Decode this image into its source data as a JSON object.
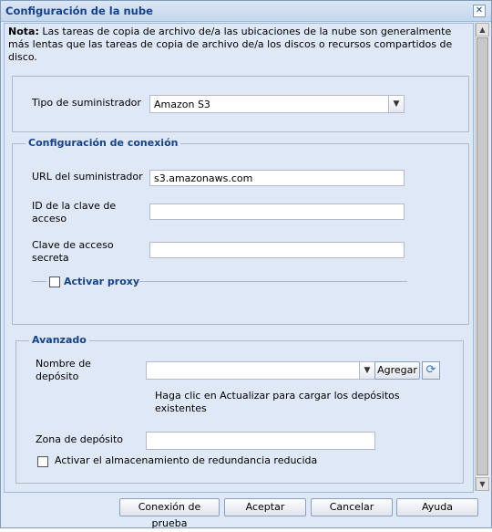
{
  "dialog": {
    "title": "Configuración de la nube",
    "close_label": "✕"
  },
  "note": {
    "bold": "Nota:",
    "text": " Las tareas de copia de archivo de/a las ubicaciones de la nube son generalmente más lentas que las tareas de copia de archivo de/a los discos o recursos compartidos de disco."
  },
  "provider": {
    "label": "Tipo de suministrador",
    "value": "Amazon S3"
  },
  "connection": {
    "legend": "Configuración de conexión",
    "url_label": "URL del suministrador",
    "url_value": "s3.amazonaws.com",
    "key_id_label_1": "ID de la clave de",
    "key_id_label_2": "acceso",
    "key_id_value": "",
    "secret_label_1": "Clave de acceso",
    "secret_label_2": "secreta",
    "secret_value": "",
    "proxy_label": "Activar proxy"
  },
  "advanced": {
    "legend": "Avanzado",
    "bucket_label_1": "Nombre de",
    "bucket_label_2": "depósito",
    "bucket_value": "",
    "add_label": "Agregar",
    "hint_1": "Haga clic en Actualizar para cargar los depósitos",
    "hint_2": "existentes",
    "zone_label": "Zona de depósito",
    "zone_value": "",
    "rrs_label": "Activar el almacenamiento de redundancia reducida"
  },
  "buttons": {
    "test": "Conexión de prueba",
    "ok": "Aceptar",
    "cancel": "Cancelar",
    "help": "Ayuda"
  }
}
